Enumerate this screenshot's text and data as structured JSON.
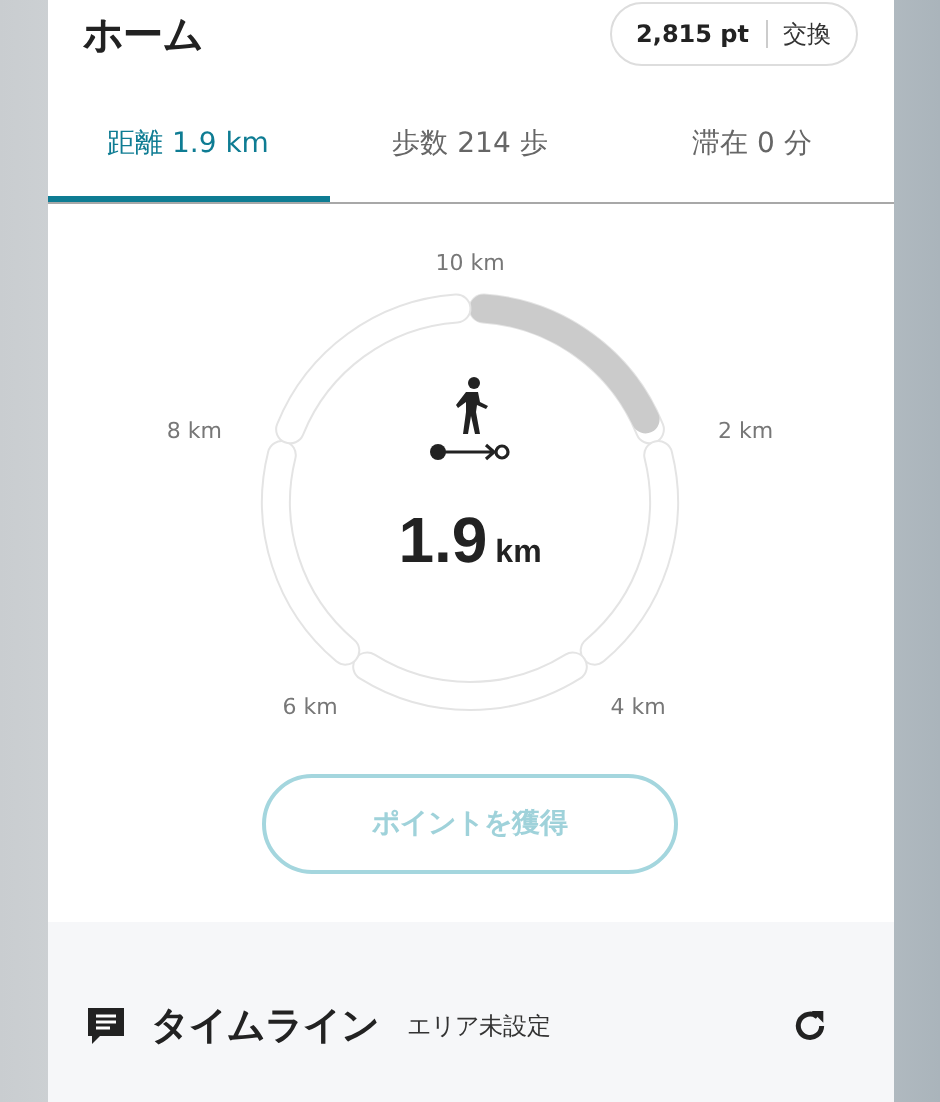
{
  "header": {
    "title": "ホーム",
    "points": "2,815 pt",
    "exchange": "交換"
  },
  "tabs": [
    {
      "label": "距離 1.9 km",
      "selected": true
    },
    {
      "label": "歩数 214 歩",
      "selected": false
    },
    {
      "label": "滞在 0 分",
      "selected": false
    }
  ],
  "gauge": {
    "labels": [
      "10 km",
      "2 km",
      "4 km",
      "6 km",
      "8 km"
    ],
    "segments": [
      {
        "filled": true
      },
      {
        "filled": false
      },
      {
        "filled": false
      },
      {
        "filled": false
      },
      {
        "filled": false
      }
    ],
    "value": "1.9",
    "unit": "km"
  },
  "action_button": {
    "label": "ポイントを獲得",
    "disabled": true
  },
  "timeline": {
    "title": "タイムライン",
    "area": "エリア未設定"
  }
}
